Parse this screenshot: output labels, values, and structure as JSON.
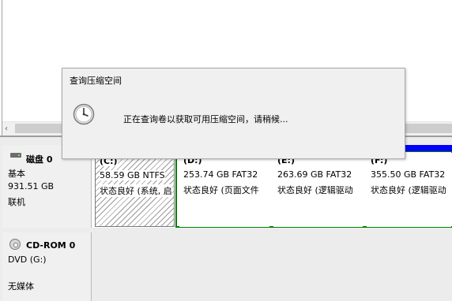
{
  "upper_pane": {
    "scroll_left_arrow": "‹"
  },
  "disks": [
    {
      "name": "磁盘 0",
      "type": "基本",
      "size": "931.51 GB",
      "status": "联机",
      "partitions": [
        {
          "label": "(C:)",
          "size_fs": "58.59 GB NTFS",
          "status": "状态良好 (系统, 启"
        },
        {
          "label": "(D:)",
          "size_fs": "253.74 GB FAT32",
          "status": "状态良好 (页面文件"
        },
        {
          "label": "(E:)",
          "size_fs": "263.69 GB FAT32",
          "status": "状态良好 (逻辑驱动"
        },
        {
          "label": "(F:)",
          "size_fs": "355.50 GB FAT32",
          "status": "状态良好 (逻辑驱动"
        }
      ]
    },
    {
      "name": "CD-ROM 0",
      "type": "DVD (G:)",
      "status": "无媒体"
    }
  ],
  "dialog": {
    "title": "查询压缩空间",
    "message": "正在查询卷以获取可用压缩空间，请稍候...",
    "icon": "clock-icon"
  },
  "colors": {
    "primary_partition_bar": "#000080",
    "logical_partition_bar": "#0000ff",
    "extended_partition_border": "#008000"
  }
}
